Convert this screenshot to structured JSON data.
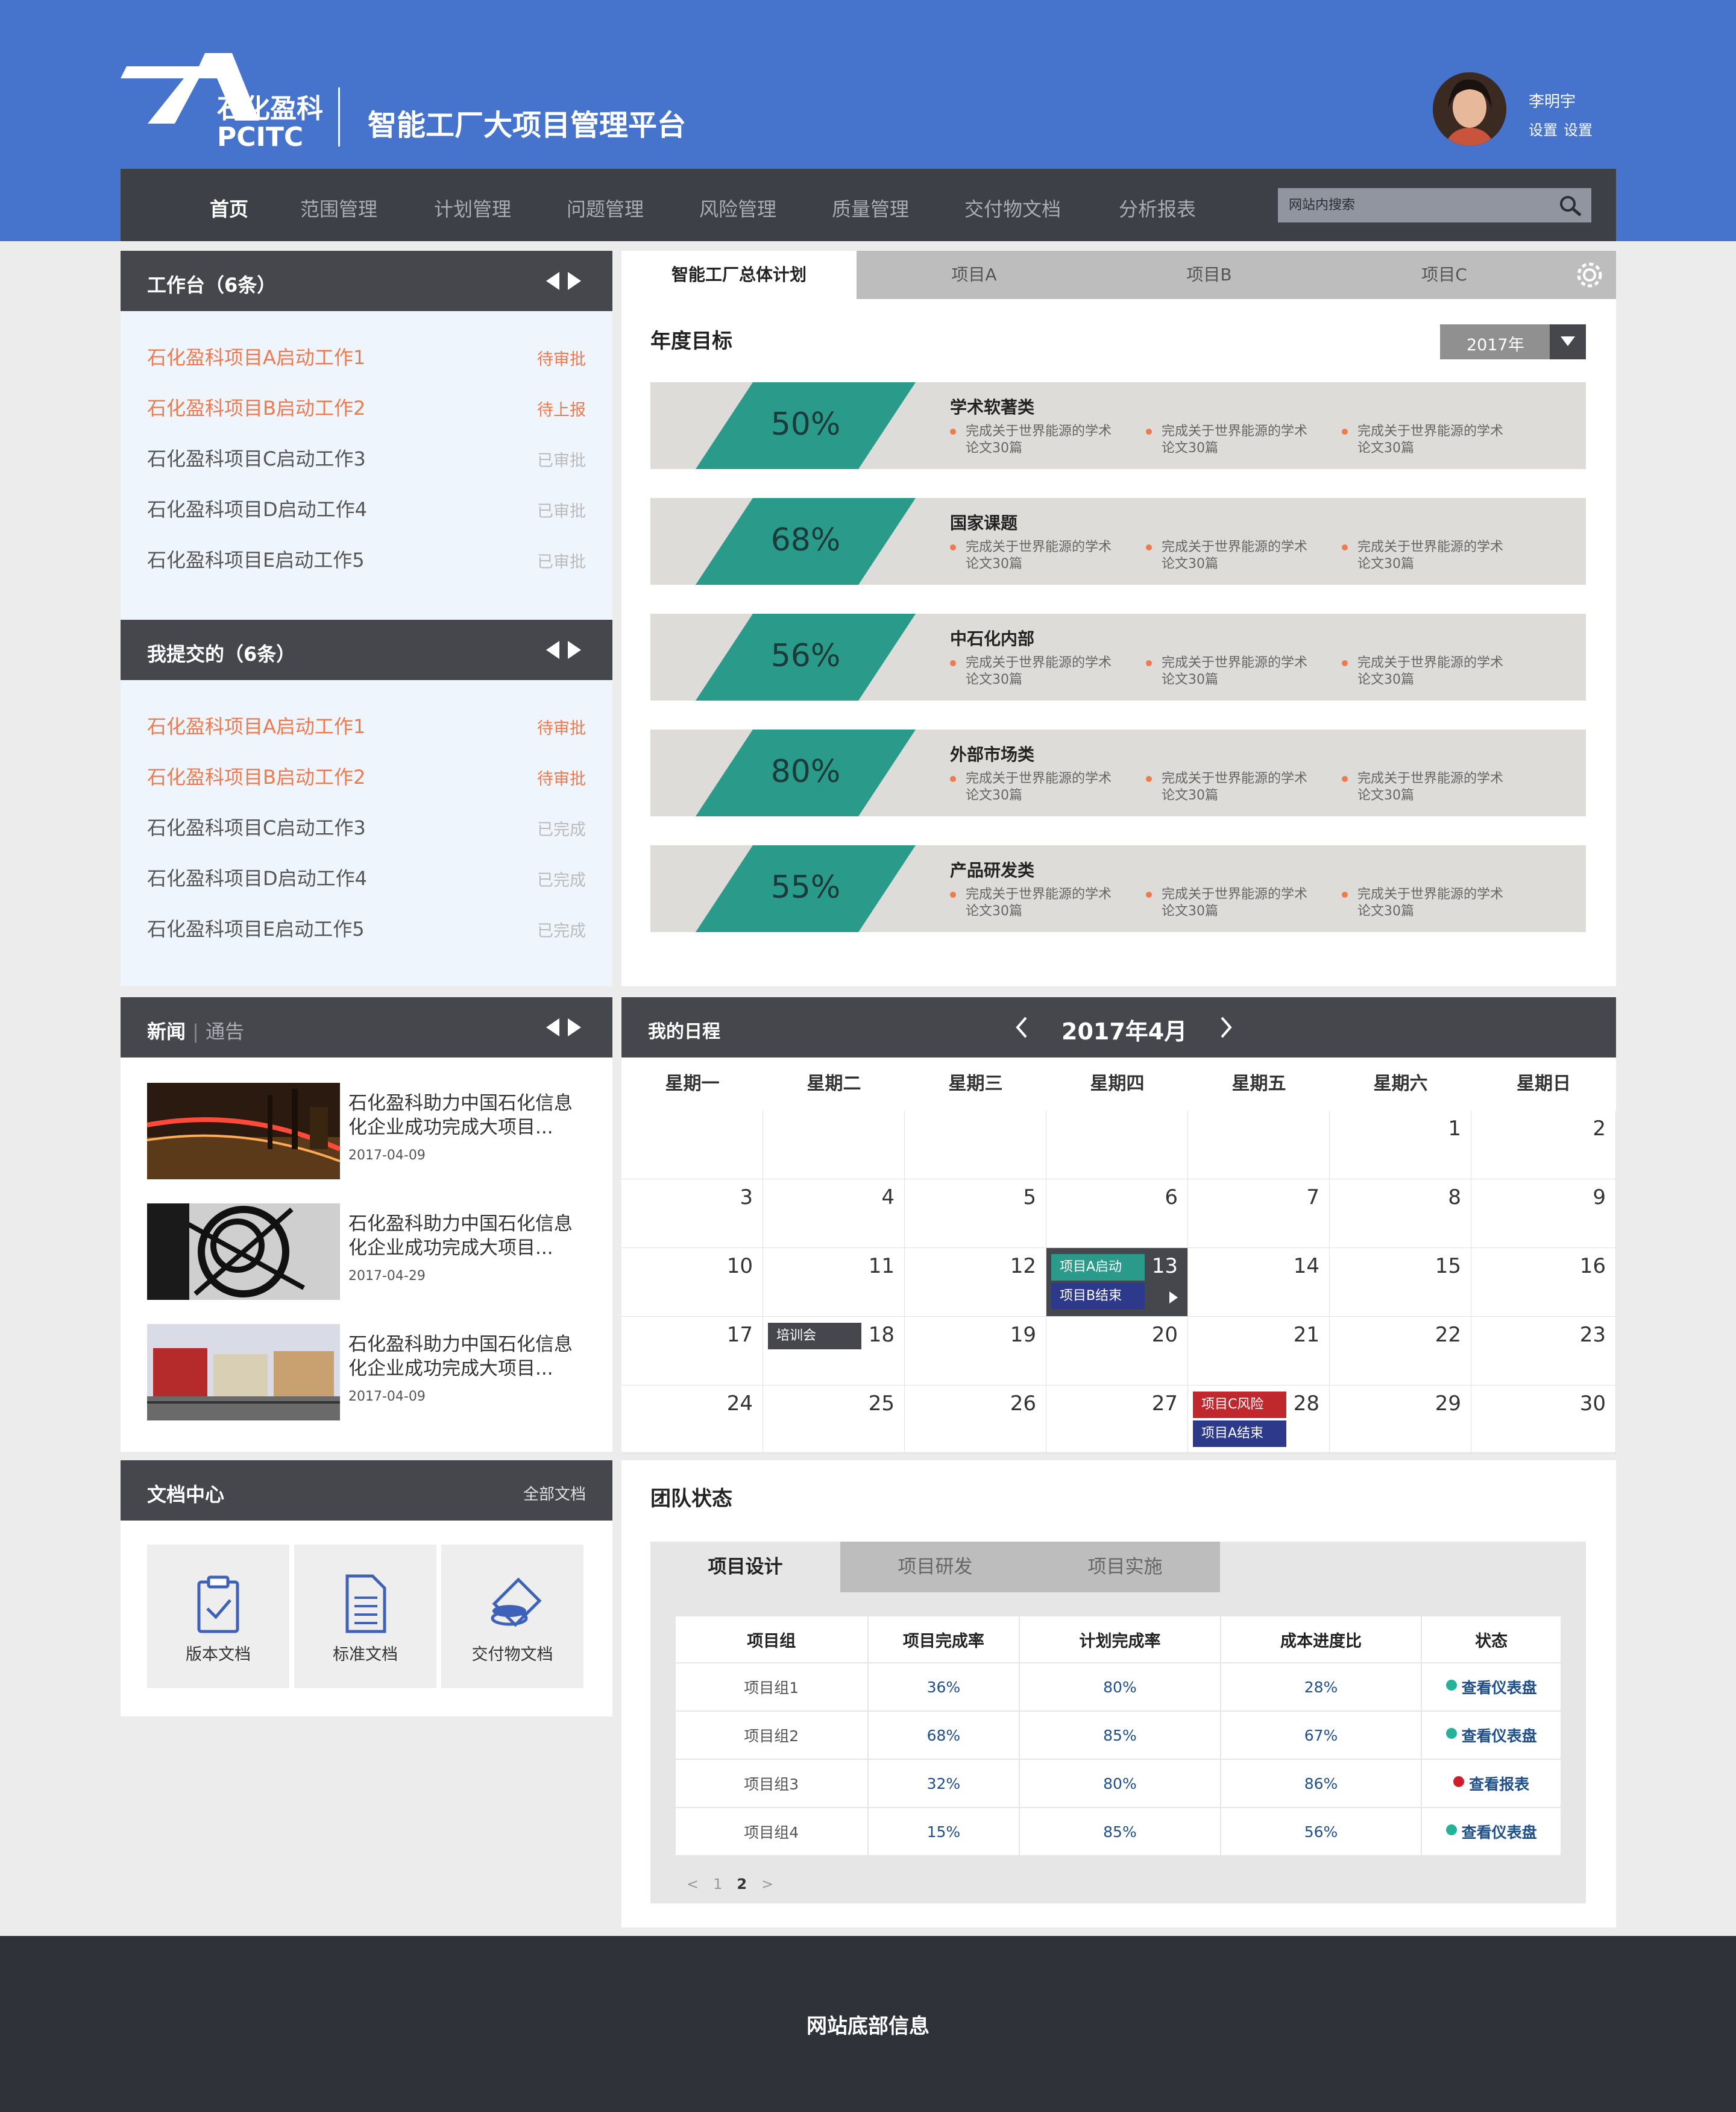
{
  "header": {
    "logo_cn": "石化盈科",
    "logo_en": "PCITC",
    "site_title": "智能工厂大项目管理平台",
    "user_name": "李明宇",
    "user_links": [
      "设置",
      "设置"
    ]
  },
  "nav": {
    "items": [
      "首页",
      "范围管理",
      "计划管理",
      "问题管理",
      "风险管理",
      "质量管理",
      "交付物文档",
      "分析报表"
    ],
    "search_placeholder": "网站内搜索"
  },
  "workbench": {
    "title": "工作台（6条）",
    "items": [
      {
        "text": "石化盈科项目A启动工作1",
        "status": "待审批"
      },
      {
        "text": "石化盈科项目B启动工作2",
        "status": "待上报"
      },
      {
        "text": "石化盈科项目C启动工作3",
        "status": "已审批"
      },
      {
        "text": "石化盈科项目D启动工作4",
        "status": "已审批"
      },
      {
        "text": "石化盈科项目E启动工作5",
        "status": "已审批"
      }
    ]
  },
  "submitted": {
    "title": "我提交的（6条）",
    "items": [
      {
        "text": "石化盈科项目A启动工作1",
        "status": "待审批"
      },
      {
        "text": "石化盈科项目B启动工作2",
        "status": "待审批"
      },
      {
        "text": "石化盈科项目C启动工作3",
        "status": "已完成"
      },
      {
        "text": "石化盈科项目D启动工作4",
        "status": "已完成"
      },
      {
        "text": "石化盈科项目E启动工作5",
        "status": "已完成"
      }
    ]
  },
  "plan": {
    "tabs": [
      "智能工厂总体计划",
      "项目A",
      "项目B",
      "项目C"
    ],
    "section_title": "年度目标",
    "year": "2017年",
    "goals": [
      {
        "pct": "50%",
        "category": "学术软著类",
        "bullets": [
          "完成关于世界能源的学术论文30篇",
          "完成关于世界能源的学术论文30篇",
          "完成关于世界能源的学术论文30篇"
        ]
      },
      {
        "pct": "68%",
        "category": "国家课题",
        "bullets": [
          "完成关于世界能源的学术论文30篇",
          "完成关于世界能源的学术论文30篇",
          "完成关于世界能源的学术论文30篇"
        ]
      },
      {
        "pct": "56%",
        "category": "中石化内部",
        "bullets": [
          "完成关于世界能源的学术论文30篇",
          "完成关于世界能源的学术论文30篇",
          "完成关于世界能源的学术论文30篇"
        ]
      },
      {
        "pct": "80%",
        "category": "外部市场类",
        "bullets": [
          "完成关于世界能源的学术论文30篇",
          "完成关于世界能源的学术论文30篇",
          "完成关于世界能源的学术论文30篇"
        ]
      },
      {
        "pct": "55%",
        "category": "产品研发类",
        "bullets": [
          "完成关于世界能源的学术论文30篇",
          "完成关于世界能源的学术论文30篇",
          "完成关于世界能源的学术论文30篇"
        ]
      }
    ]
  },
  "news": {
    "title": "新闻",
    "sep": "|",
    "title2": "通告",
    "items": [
      {
        "title": "石化盈科助力中国石化信息化企业成功完成大项目...",
        "date": "2017-04-09"
      },
      {
        "title": "石化盈科助力中国石化信息化企业成功完成大项目...",
        "date": "2017-04-29"
      },
      {
        "title": "石化盈科助力中国石化信息化企业成功完成大项目...",
        "date": "2017-04-09"
      }
    ]
  },
  "calendar": {
    "title": "我的日程",
    "month": "2017年4月",
    "weekdays": [
      "星期一",
      "星期二",
      "星期三",
      "星期四",
      "星期五",
      "星期六",
      "星期日"
    ],
    "events": {
      "e1": "项目A启动",
      "e2": "项目B结束",
      "e3": "培训会",
      "e4": "项目C风险",
      "e5": "项目A结束"
    }
  },
  "docs": {
    "title": "文档中心",
    "all_link": "全部文档",
    "items": [
      "版本文档",
      "标准文档",
      "交付物文档"
    ]
  },
  "team": {
    "title": "团队状态",
    "tabs": [
      "项目设计",
      "项目研发",
      "项目实施"
    ],
    "columns": [
      "项目组",
      "项目完成率",
      "计划完成率",
      "成本进度比",
      "状态"
    ],
    "rows": [
      {
        "group": "项目组1",
        "done": "36%",
        "plan": "80%",
        "cost": "28%",
        "status": "查看仪表盘",
        "color": "#23b39a"
      },
      {
        "group": "项目组2",
        "done": "68%",
        "plan": "85%",
        "cost": "67%",
        "status": "查看仪表盘",
        "color": "#23b39a"
      },
      {
        "group": "项目组3",
        "done": "32%",
        "plan": "80%",
        "cost": "86%",
        "status": "查看报表",
        "color": "#cc1f2a"
      },
      {
        "group": "项目组4",
        "done": "15%",
        "plan": "85%",
        "cost": "56%",
        "status": "查看仪表盘",
        "color": "#23b39a"
      }
    ],
    "pager": {
      "prev": "<",
      "pages": [
        "1",
        "2"
      ],
      "next": ">"
    }
  },
  "footer": {
    "text": "网站底部信息"
  },
  "colors": {
    "primary": "#4673cc",
    "nav": "#3d4047",
    "teal": "#2a9a8a",
    "orange": "#ee7a4e"
  }
}
